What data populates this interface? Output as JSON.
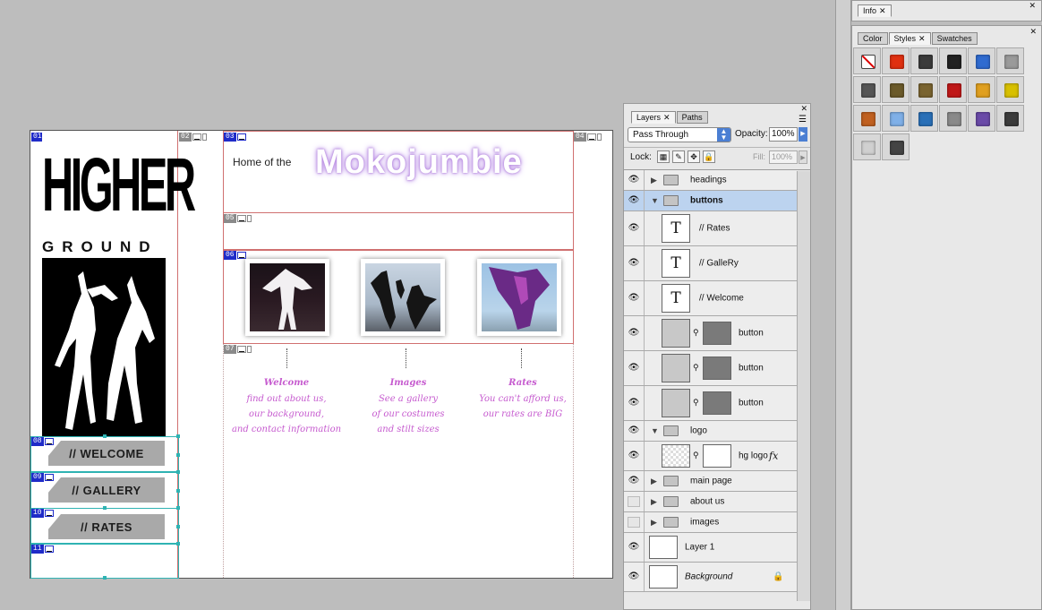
{
  "document": {
    "slices": [
      "01",
      "02",
      "03",
      "04",
      "05",
      "06",
      "07",
      "08",
      "09",
      "10",
      "11"
    ],
    "logo": {
      "line1": "HIGHER",
      "line2": "GROUND"
    },
    "header": {
      "prefix": "Home of the",
      "title": "Mokojumbie"
    },
    "nav": [
      {
        "label": "// WELCOME"
      },
      {
        "label": "// GALLERY"
      },
      {
        "label": "// RATES"
      }
    ],
    "captions": [
      {
        "heading": "Welcome",
        "body": [
          "find out about us,",
          "our background,",
          "and contact information"
        ]
      },
      {
        "heading": "Images",
        "body": [
          "See a gallery",
          "of our costumes",
          "and stilt sizes"
        ]
      },
      {
        "heading": "Rates",
        "body": [
          "You can't afford us,",
          "our rates are BIG"
        ]
      }
    ]
  },
  "info_panel": {
    "tab": "Info"
  },
  "styles_panel": {
    "tabs": [
      "Color",
      "Styles",
      "Swatches"
    ],
    "active_tab": "Styles",
    "swatch_colors": [
      "none",
      "#e03010",
      "#3b3b3b",
      "#222222",
      "#2f6bd0",
      "#9a9a9a",
      "#555555",
      "#6b5a2a",
      "#7a6430",
      "#c01818",
      "#e0a020",
      "#d8c000",
      "#c06020",
      "#7fb0e8",
      "#2a70b8",
      "#8a8a8a",
      "#6a4aa8",
      "#3b3b3b",
      "#d0d0d0",
      "#444444"
    ]
  },
  "layers_panel": {
    "tabs": [
      "Layers",
      "Paths"
    ],
    "active_tab": "Layers",
    "blend_mode": "Pass Through",
    "opacity_label": "Opacity:",
    "opacity_value": "100%",
    "lock_label": "Lock:",
    "fill_label": "Fill:",
    "fill_value": "100%",
    "layers": [
      {
        "name": "headings",
        "kind": "group",
        "visible": true,
        "expanded": false
      },
      {
        "name": "buttons",
        "kind": "group",
        "visible": true,
        "expanded": true,
        "selected": true
      },
      {
        "name": "// Rates",
        "kind": "text",
        "visible": true
      },
      {
        "name": "// GalleRy",
        "kind": "text",
        "visible": true
      },
      {
        "name": "// Welcome",
        "kind": "text",
        "visible": true
      },
      {
        "name": "button",
        "kind": "shape",
        "visible": true
      },
      {
        "name": "button",
        "kind": "shape",
        "visible": true
      },
      {
        "name": "button",
        "kind": "shape",
        "visible": true
      },
      {
        "name": "logo",
        "kind": "group",
        "visible": true,
        "expanded": true
      },
      {
        "name": "hg logo",
        "kind": "image",
        "visible": true,
        "fx": "fx"
      },
      {
        "name": "main page",
        "kind": "group",
        "visible": true,
        "expanded": false
      },
      {
        "name": "about us",
        "kind": "group",
        "visible": false,
        "expanded": false
      },
      {
        "name": "images",
        "kind": "group",
        "visible": false,
        "expanded": false
      },
      {
        "name": "Layer 1",
        "kind": "plain",
        "visible": true
      },
      {
        "name": "Background",
        "kind": "background",
        "visible": true
      }
    ]
  }
}
